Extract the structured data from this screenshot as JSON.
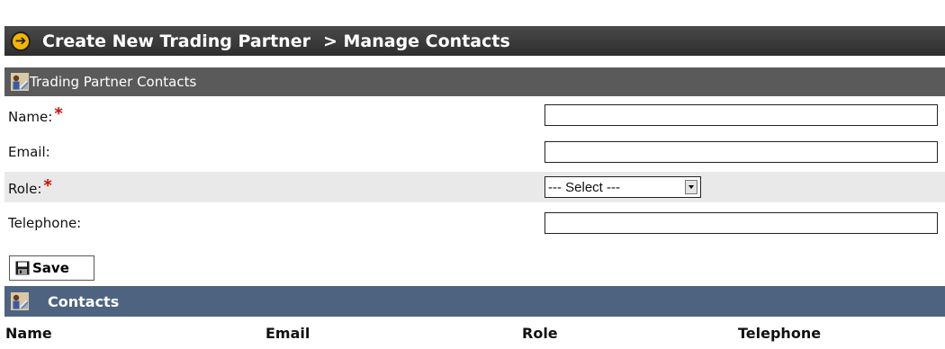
{
  "header": {
    "title": "Create New Trading Partner",
    "subtitle": "> Manage Contacts",
    "icon": "arrow-right-circle-icon",
    "accent_color": "#f2b400"
  },
  "contacts_form": {
    "section_title": "Trading Partner Contacts",
    "icon": "people-icon",
    "fields": {
      "name": {
        "label": "Name:",
        "required_marker": "*",
        "value": ""
      },
      "email": {
        "label": "Email:",
        "value": ""
      },
      "role": {
        "label": "Role:",
        "required_marker": "*",
        "selected": "--- Select ---"
      },
      "telephone": {
        "label": "Telephone:",
        "value": ""
      }
    },
    "save_label": "Save",
    "save_icon": "floppy-disk-icon"
  },
  "contacts_list": {
    "section_title": "Contacts",
    "icon": "people-icon",
    "header_color": "#4e6380",
    "columns": [
      "Name",
      "Email",
      "Role",
      "Telephone"
    ]
  }
}
